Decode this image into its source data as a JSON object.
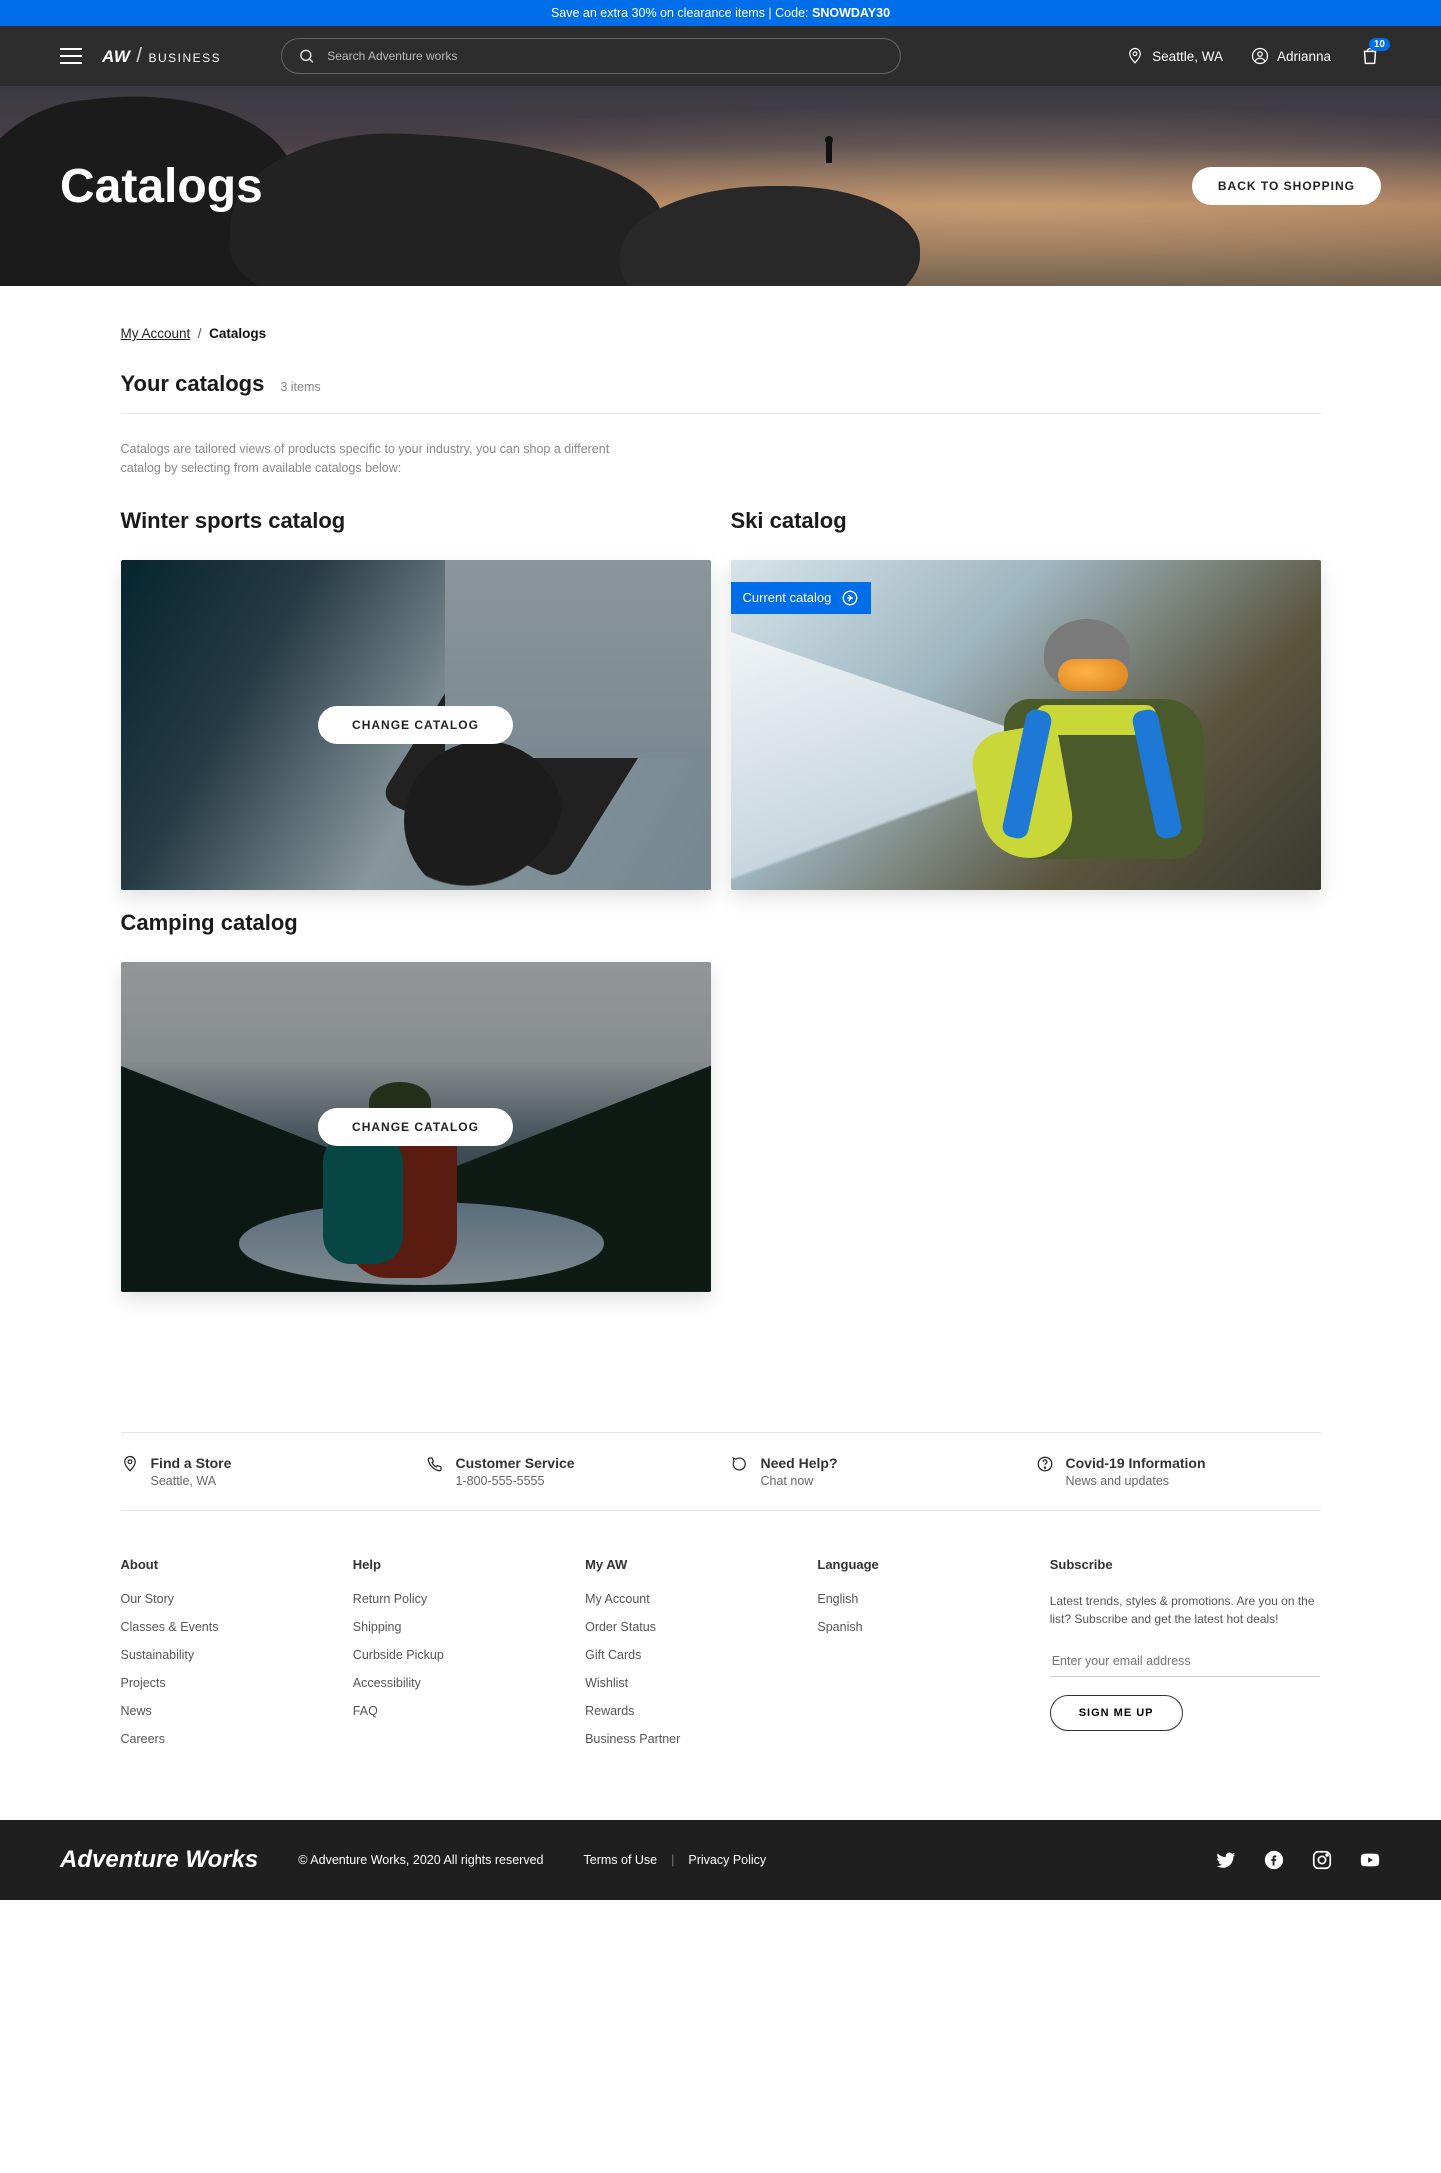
{
  "promo": {
    "text": "Save an extra 30% on clearance items | Code: ",
    "code": "SNOWDAY30"
  },
  "header": {
    "logo_main": "AW",
    "logo_sub": "BUSINESS",
    "search_placeholder": "Search Adventure works",
    "location": "Seattle, WA",
    "user": "Adrianna",
    "cart_count": "10"
  },
  "hero": {
    "title": "Catalogs",
    "back_button": "BACK TO SHOPPING"
  },
  "breadcrumb": {
    "root": "My Account",
    "sep": "/",
    "current": "Catalogs"
  },
  "page": {
    "title": "Your catalogs",
    "count": "3 items",
    "description": "Catalogs are tailored views of products specific to your industry, you can shop a different catalog by selecting from available catalogs below:"
  },
  "catalogs": {
    "winter": {
      "title": "Winter sports catalog",
      "cta": "CHANGE CATALOG"
    },
    "ski": {
      "title": "Ski catalog",
      "badge": "Current catalog"
    },
    "camp": {
      "title": "Camping catalog",
      "cta": "CHANGE CATALOG"
    }
  },
  "services": [
    {
      "title": "Find a Store",
      "sub": "Seattle, WA"
    },
    {
      "title": "Customer Service",
      "sub": "1-800-555-5555"
    },
    {
      "title": "Need Help?",
      "sub": "Chat now"
    },
    {
      "title": "Covid-19 Information",
      "sub": "News and updates"
    }
  ],
  "footer": {
    "about": {
      "h": "About",
      "links": [
        "Our Story",
        "Classes & Events",
        "Sustainability",
        "Projects",
        "News",
        "Careers"
      ]
    },
    "help": {
      "h": "Help",
      "links": [
        "Return Policy",
        "Shipping",
        "Curbside Pickup",
        "Accessibility",
        "FAQ"
      ]
    },
    "myaw": {
      "h": "My AW",
      "links": [
        "My Account",
        "Order Status",
        "Gift Cards",
        "Wishlist",
        "Rewards",
        "Business Partner"
      ]
    },
    "lang": {
      "h": "Language",
      "links": [
        "English",
        "Spanish"
      ]
    },
    "sub": {
      "h": "Subscribe",
      "desc": "Latest trends, styles & promotions. Are you on the list? Subscribe and get the latest hot deals!",
      "placeholder": "Enter your email address",
      "button": "SIGN ME UP"
    }
  },
  "footer_bar": {
    "logo": "Adventure Works",
    "copyright": "© Adventure Works, 2020 All rights reserved",
    "terms": "Terms of Use",
    "privacy": "Privacy Policy"
  }
}
